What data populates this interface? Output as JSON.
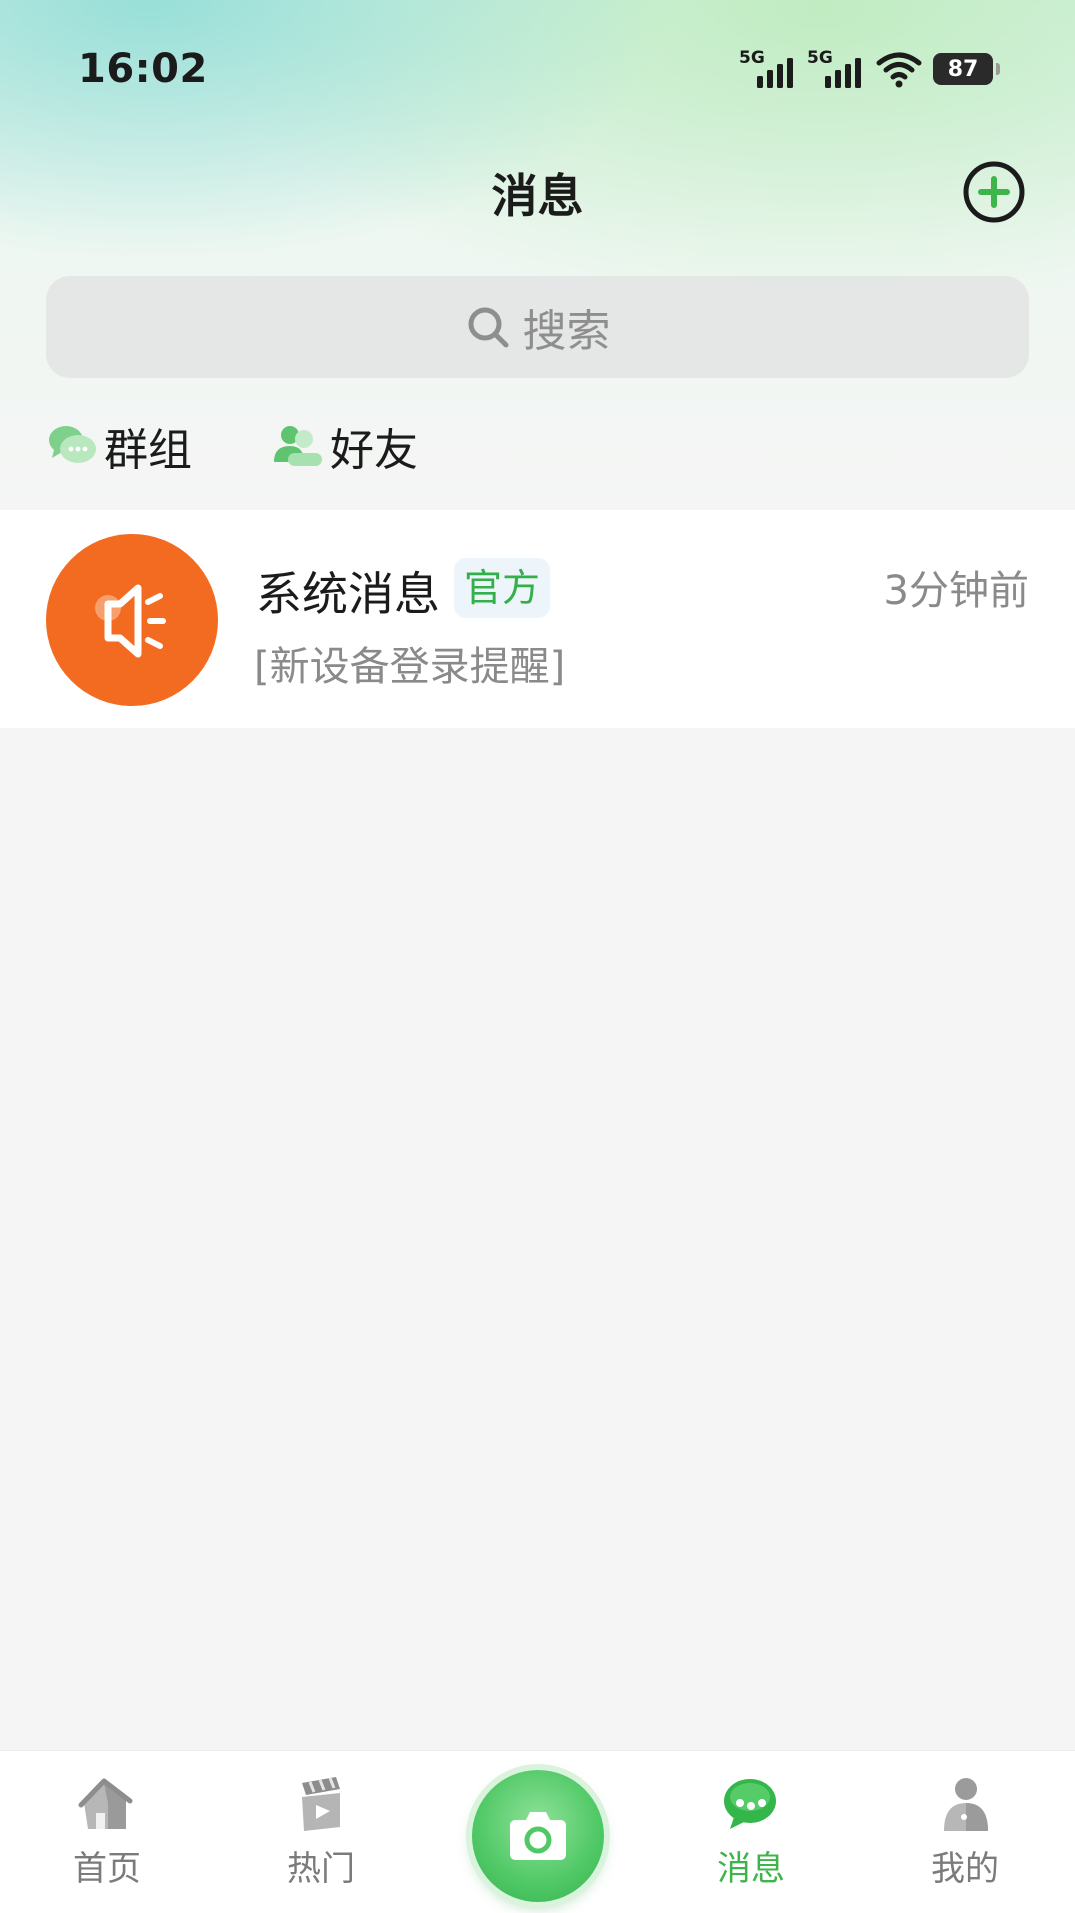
{
  "status_bar": {
    "time": "16:02",
    "network_1": "5G",
    "network_2": "5G",
    "battery": "87"
  },
  "header": {
    "title": "消息"
  },
  "search": {
    "placeholder": "搜索"
  },
  "quick_links": [
    {
      "label": "群组",
      "icon": "group-chat-icon"
    },
    {
      "label": "好友",
      "icon": "friends-icon"
    }
  ],
  "messages": [
    {
      "title": "系统消息",
      "badge": "官方",
      "time": "3分钟前",
      "preview": "[新设备登录提醒]",
      "icon": "megaphone-icon"
    }
  ],
  "tab_bar": {
    "tabs": [
      {
        "label": "首页",
        "icon": "home-icon",
        "active": false
      },
      {
        "label": "热门",
        "icon": "video-icon",
        "active": false
      },
      {
        "label": "消息",
        "icon": "message-icon",
        "active": true
      },
      {
        "label": "我的",
        "icon": "profile-icon",
        "active": false
      }
    ],
    "center_icon": "camera-icon"
  },
  "colors": {
    "accent_green": "#3db54a",
    "avatar_orange": "#f36b21",
    "muted_text": "#8a8a8a"
  }
}
